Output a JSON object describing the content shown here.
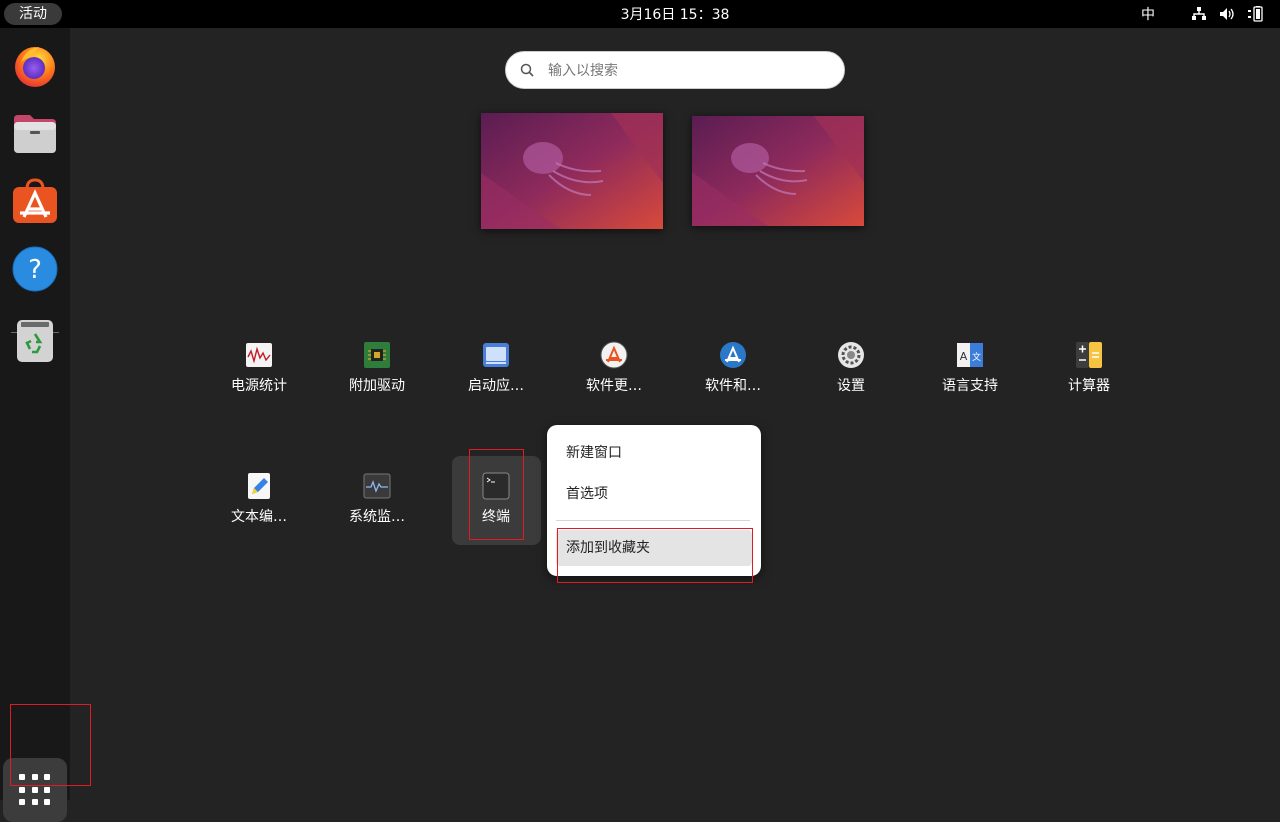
{
  "topbar": {
    "activities_label": "活动",
    "clock": "3月16日  15：38",
    "input_method": "中",
    "icons": [
      "network-icon",
      "volume-icon",
      "battery-icon"
    ]
  },
  "dock": {
    "items": [
      {
        "name": "firefox-icon"
      },
      {
        "name": "files-icon"
      },
      {
        "name": "app-center-icon"
      },
      {
        "name": "help-icon"
      },
      {
        "name": "trash-icon"
      }
    ],
    "show_apps_icon": "grid-icon"
  },
  "search": {
    "placeholder": "输入以搜索",
    "value": ""
  },
  "workspaces": [
    "workspace-1",
    "workspace-2"
  ],
  "apps": {
    "row1": [
      {
        "label": "电源统计",
        "icon": "power-statistics-icon"
      },
      {
        "label": "附加驱动",
        "icon": "additional-drivers-icon"
      },
      {
        "label": "启动应…",
        "icon": "startup-apps-icon"
      },
      {
        "label": "软件更…",
        "icon": "software-updater-icon"
      },
      {
        "label": "软件和…",
        "icon": "software-sources-icon"
      },
      {
        "label": "设置",
        "icon": "settings-icon"
      },
      {
        "label": "语言支持",
        "icon": "language-support-icon"
      },
      {
        "label": "计算器",
        "icon": "calculator-icon"
      }
    ],
    "row2": [
      {
        "label": "文本编…",
        "icon": "text-editor-icon"
      },
      {
        "label": "系统监…",
        "icon": "system-monitor-icon"
      },
      {
        "label": "终端",
        "icon": "terminal-icon"
      }
    ]
  },
  "context_menu": {
    "items": [
      "新建窗口",
      "首选项",
      "添加到收藏夹"
    ]
  },
  "colors": {
    "annotation": "#e01b24",
    "ubuntu_orange": "#e95420",
    "background": "#232323"
  }
}
